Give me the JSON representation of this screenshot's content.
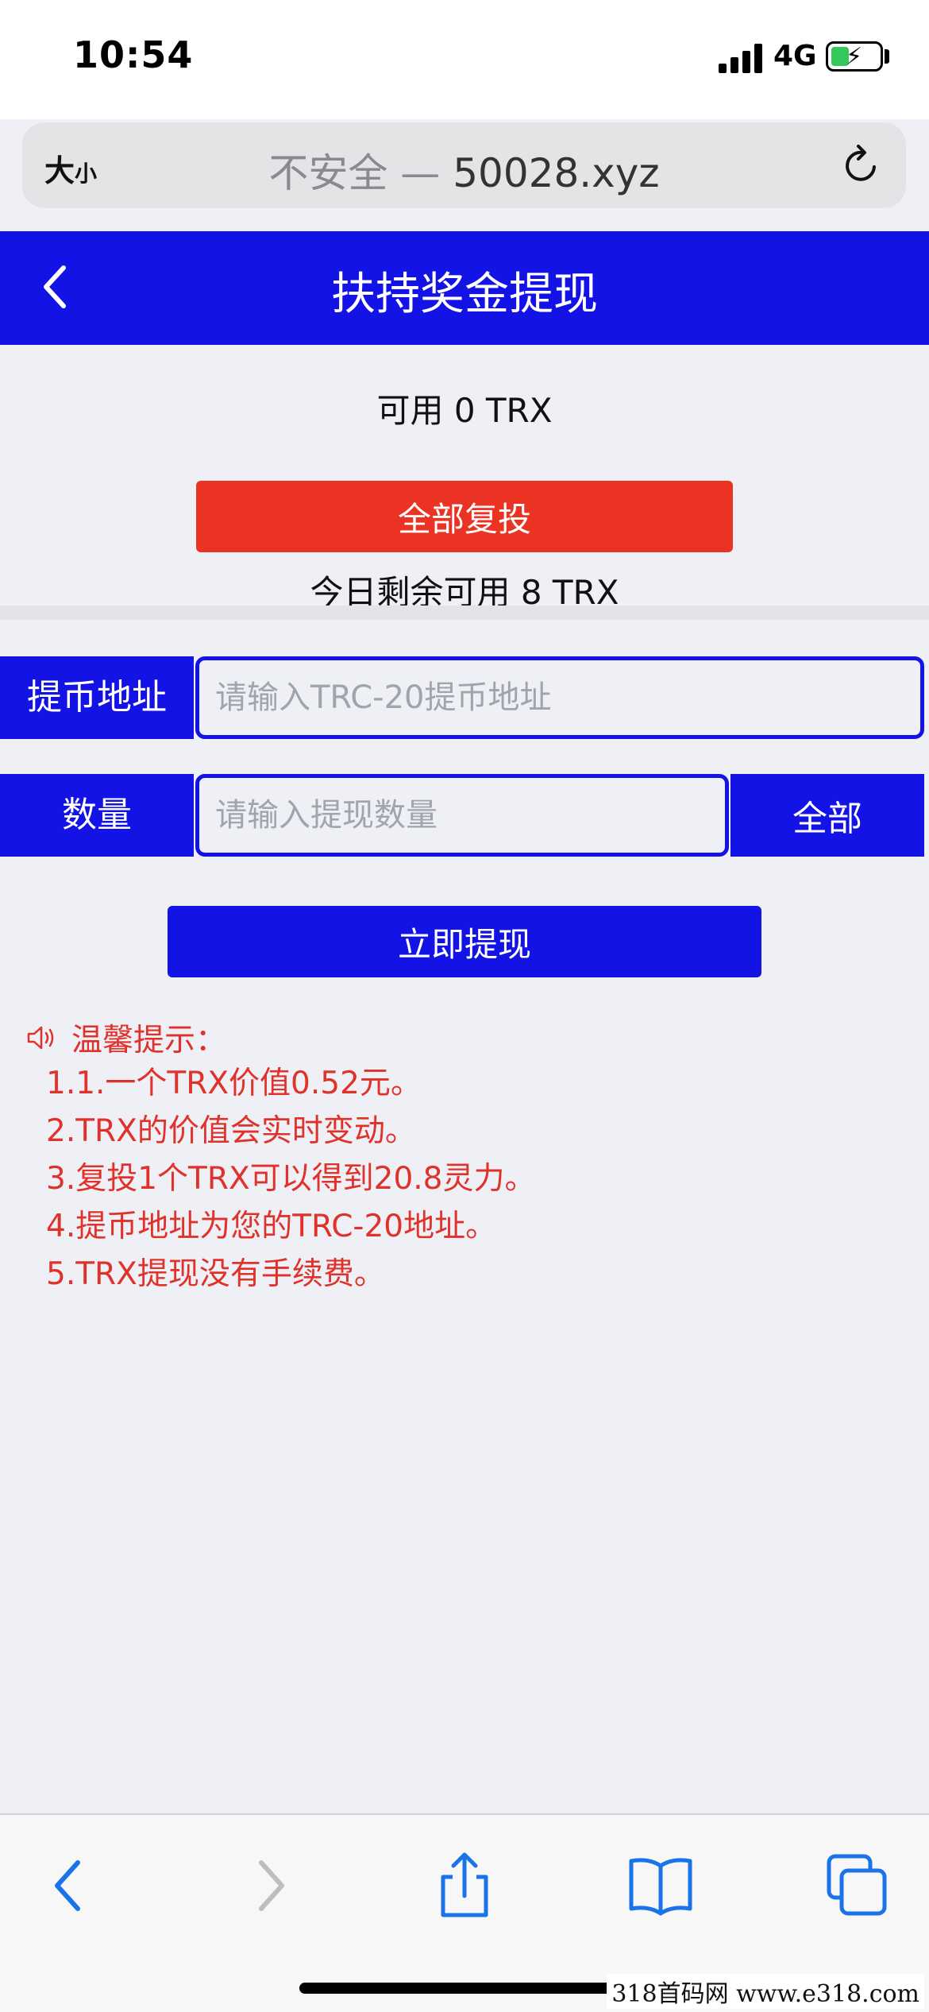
{
  "status_bar": {
    "time": "10:54",
    "network": "4G"
  },
  "address_bar": {
    "text_size_label": "大",
    "text_size_small": "小",
    "url_prefix": "不安全 — ",
    "url": "50028.xyz"
  },
  "header": {
    "title": "扶持奖金提现"
  },
  "balance": {
    "available": "可用 0 TRX",
    "remaining_today": "今日剩余可用 8 TRX"
  },
  "buttons": {
    "reinvest_all": "全部复投",
    "all": "全部",
    "withdraw_now": "立即提现"
  },
  "form": {
    "address_label": "提币地址",
    "address_placeholder": "请输入TRC-20提币地址",
    "amount_label": "数量",
    "amount_placeholder": "请输入提现数量"
  },
  "tips": {
    "title": "温馨提示：",
    "items": [
      "1.1.一个TRX价值0.52元。",
      "2.TRX的价值会实时变动。",
      "3.复投1个TRX可以得到20.8灵力。",
      "4.提币地址为您的TRC-20地址。",
      "5.TRX提现没有手续费。"
    ]
  },
  "watermark": "318首码网  www.e318.com",
  "colors": {
    "primary_blue": "#1313e6",
    "reinvest_red": "#ea3323",
    "tip_red": "#e0322a",
    "background": "#eef0f6"
  }
}
